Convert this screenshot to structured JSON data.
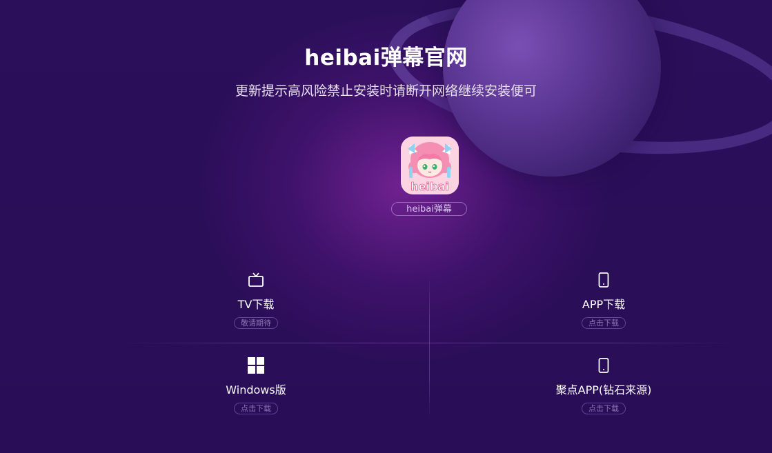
{
  "header": {
    "title": "heibai弹幕官网",
    "subtitle": "更新提示高风险禁止安装时请断开网络继续安装便可"
  },
  "app": {
    "icon_name": "app-logo-icon",
    "icon_text": "heibai",
    "name": "heibai弹幕"
  },
  "downloads": [
    {
      "icon": "tv-icon",
      "label": "TV下载",
      "tag": "敬请期待"
    },
    {
      "icon": "phone-icon",
      "label": "APP下载",
      "tag": "点击下载"
    },
    {
      "icon": "windows-icon",
      "label": "Windows版",
      "tag": "点击下载"
    },
    {
      "icon": "phone-icon",
      "label": "聚点APP(钻石来源)",
      "tag": "点击下载"
    }
  ],
  "colors": {
    "background": "#2a0e58",
    "glow": "#aa32be",
    "tag_border": "#9670c8"
  }
}
